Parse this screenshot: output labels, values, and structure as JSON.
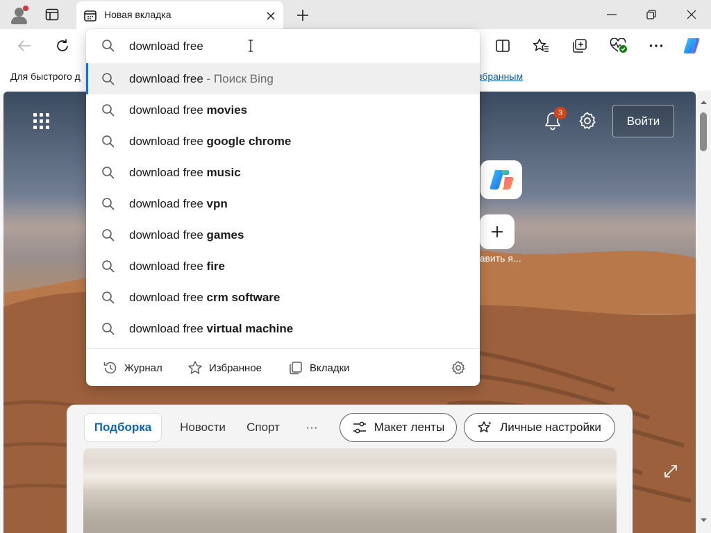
{
  "tab": {
    "title": "Новая вкладка"
  },
  "favorites_bar": {
    "text": "Для быстрого д",
    "link": "Избранным"
  },
  "address": {
    "value": "download free",
    "suggestions": [
      {
        "prefix": "download free",
        "bold": "",
        "hint": " - Поиск Bing",
        "active": true
      },
      {
        "prefix": "download free ",
        "bold": "movies",
        "hint": ""
      },
      {
        "prefix": "download free ",
        "bold": "google chrome",
        "hint": ""
      },
      {
        "prefix": "download free ",
        "bold": "music",
        "hint": ""
      },
      {
        "prefix": "download free ",
        "bold": "vpn",
        "hint": ""
      },
      {
        "prefix": "download free ",
        "bold": "games",
        "hint": ""
      },
      {
        "prefix": "download free ",
        "bold": "fire",
        "hint": ""
      },
      {
        "prefix": "download free ",
        "bold": "crm software",
        "hint": ""
      },
      {
        "prefix": "download free ",
        "bold": "virtual machine",
        "hint": ""
      }
    ],
    "footer": {
      "history": "Журнал",
      "favorites": "Избранное",
      "tabs": "Вкладки"
    }
  },
  "newtab": {
    "signin_label": "Войти",
    "notification_count": "3",
    "add_site_label": "бавить я...",
    "feed_tabs": {
      "selected": "Подборка",
      "news": "Новости",
      "sport": "Спорт",
      "more": "···"
    },
    "layout_button": "Макет ленты",
    "personalize_button": "Личные настройки"
  },
  "colors": {
    "accent": "#1d6fc0",
    "badge": "#d1451b",
    "link": "#0e63b6"
  }
}
